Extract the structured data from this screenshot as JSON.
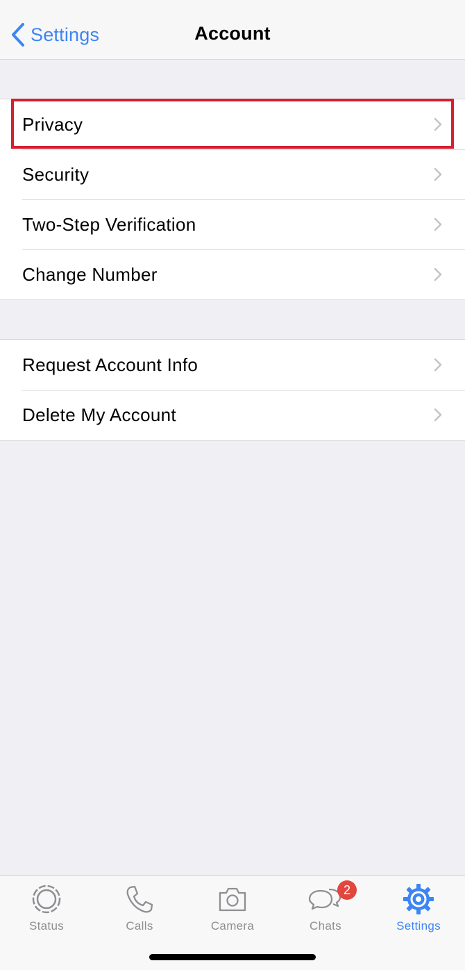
{
  "navbar": {
    "back_label": "Settings",
    "title": "Account"
  },
  "groups": [
    {
      "items": [
        {
          "label": "Privacy",
          "highlighted": true
        },
        {
          "label": "Security"
        },
        {
          "label": "Two-Step Verification"
        },
        {
          "label": "Change Number"
        }
      ]
    },
    {
      "items": [
        {
          "label": "Request Account Info"
        },
        {
          "label": "Delete My Account"
        }
      ]
    }
  ],
  "tabbar": {
    "tabs": [
      {
        "label": "Status",
        "icon": "status-icon"
      },
      {
        "label": "Calls",
        "icon": "phone-icon"
      },
      {
        "label": "Camera",
        "icon": "camera-icon"
      },
      {
        "label": "Chats",
        "icon": "chats-icon",
        "badge": "2"
      },
      {
        "label": "Settings",
        "icon": "gear-icon",
        "active": true
      }
    ]
  },
  "colors": {
    "accent": "#3d85f5",
    "highlight_border": "#d4202f",
    "badge": "#e3463d",
    "background": "#efeff4",
    "inactive_tab": "#8e8e93"
  }
}
